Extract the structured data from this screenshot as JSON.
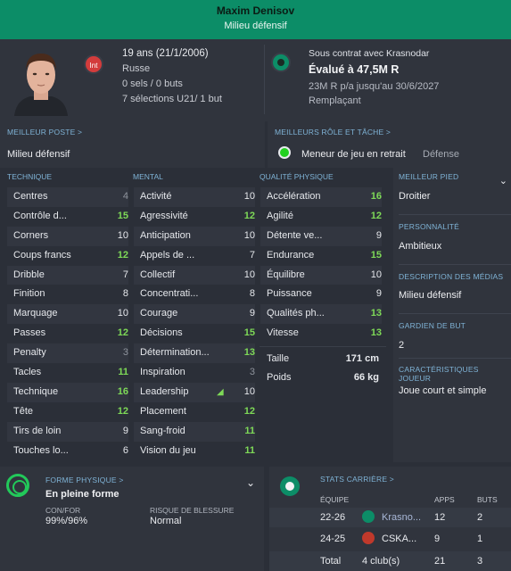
{
  "header": {
    "name": "Maxim Denisov",
    "position": "Milieu défensif"
  },
  "bio": {
    "age": "19 ans (21/1/2006)",
    "nationality": "Russe",
    "caps": "0 sels / 0 buts",
    "u21": "7 sélections U21/ 1 but",
    "int_badge": "Int"
  },
  "contract": {
    "club": "Sous contrat avec Krasnodar",
    "value": "Évalué à 47,5M R",
    "wage": "23M R p/a jusqu'au 30/6/2027",
    "status": "Remplaçant"
  },
  "best_position": {
    "label": "MEILLEUR POSTE >",
    "value": "Milieu défensif"
  },
  "best_role": {
    "label": "MEILLEURS RÔLE ET TÂCHE >",
    "role": "Meneur de jeu en retrait",
    "duty": "Défense"
  },
  "columns": {
    "technique": "TECHNIQUE",
    "mental": "MENTAL",
    "physical": "QUALITÉ PHYSIQUE"
  },
  "technique": [
    {
      "name": "Centres",
      "value": "4",
      "style": "grey"
    },
    {
      "name": "Contrôle d...",
      "value": "15",
      "style": "green"
    },
    {
      "name": "Corners",
      "value": "10",
      "style": "white"
    },
    {
      "name": "Coups francs",
      "value": "12",
      "style": "green"
    },
    {
      "name": "Dribble",
      "value": "7",
      "style": "white"
    },
    {
      "name": "Finition",
      "value": "8",
      "style": "white"
    },
    {
      "name": "Marquage",
      "value": "10",
      "style": "white"
    },
    {
      "name": "Passes",
      "value": "12",
      "style": "green"
    },
    {
      "name": "Penalty",
      "value": "3",
      "style": "grey"
    },
    {
      "name": "Tacles",
      "value": "11",
      "style": "green"
    },
    {
      "name": "Technique",
      "value": "16",
      "style": "green"
    },
    {
      "name": "Tête",
      "value": "12",
      "style": "green"
    },
    {
      "name": "Tirs de loin",
      "value": "9",
      "style": "white"
    },
    {
      "name": "Touches lo...",
      "value": "6",
      "style": "white"
    }
  ],
  "mental": [
    {
      "name": "Activité",
      "value": "10",
      "style": "white"
    },
    {
      "name": "Agressivité",
      "value": "12",
      "style": "green"
    },
    {
      "name": "Anticipation",
      "value": "10",
      "style": "white"
    },
    {
      "name": "Appels de ...",
      "value": "7",
      "style": "white"
    },
    {
      "name": "Collectif",
      "value": "10",
      "style": "white"
    },
    {
      "name": "Concentrati...",
      "value": "8",
      "style": "white"
    },
    {
      "name": "Courage",
      "value": "9",
      "style": "white"
    },
    {
      "name": "Décisions",
      "value": "15",
      "style": "green"
    },
    {
      "name": "Détermination...",
      "value": "13",
      "style": "green"
    },
    {
      "name": "Inspiration",
      "value": "3",
      "style": "grey"
    },
    {
      "name": "Leadership",
      "value": "10",
      "style": "white"
    },
    {
      "name": "Placement",
      "value": "12",
      "style": "green"
    },
    {
      "name": "Sang-froid",
      "value": "11",
      "style": "green"
    },
    {
      "name": "Vision du jeu",
      "value": "11",
      "style": "green"
    }
  ],
  "physical": [
    {
      "name": "Accélération",
      "value": "16",
      "style": "green"
    },
    {
      "name": "Agilité",
      "value": "12",
      "style": "green"
    },
    {
      "name": "Détente ve...",
      "value": "9",
      "style": "white"
    },
    {
      "name": "Endurance",
      "value": "15",
      "style": "green"
    },
    {
      "name": "Équilibre",
      "value": "10",
      "style": "white"
    },
    {
      "name": "Puissance",
      "value": "9",
      "style": "white"
    },
    {
      "name": "Qualités ph...",
      "value": "13",
      "style": "green"
    },
    {
      "name": "Vitesse",
      "value": "13",
      "style": "green"
    }
  ],
  "body": {
    "height_label": "Taille",
    "height": "171 cm",
    "weight_label": "Poids",
    "weight": "66 kg"
  },
  "side": {
    "foot_label": "MEILLEUR PIED",
    "foot": "Droitier",
    "personality_label": "PERSONNALITÉ",
    "personality": "Ambitieux",
    "media_label": "DESCRIPTION DES MÉDIAS",
    "media": "Milieu défensif",
    "gk_label": "GARDIEN DE BUT",
    "gk": "2",
    "traits_label": "CARACTÉRISTIQUES JOUEUR",
    "traits": "Joue court et simple"
  },
  "fitness": {
    "label": "FORME PHYSIQUE >",
    "value": "En pleine forme",
    "con_label": "CON/FOR",
    "con": "99%/96%",
    "injury_label": "RISQUE DE BLESSURE",
    "injury": "Normal"
  },
  "career": {
    "label": "STATS CARRIÈRE >",
    "head_team": "ÉQUIPE",
    "head_apps": "APPS",
    "head_goals": "BUTS",
    "rows": [
      {
        "season": "22-26",
        "team": "Krasno...",
        "apps": "12",
        "goals": "2"
      },
      {
        "season": "24-25",
        "team": "CSKA...",
        "apps": "9",
        "goals": "1"
      }
    ],
    "total_label": "Total",
    "total_clubs": "4 club(s)",
    "total_apps": "21",
    "total_goals": "3"
  }
}
